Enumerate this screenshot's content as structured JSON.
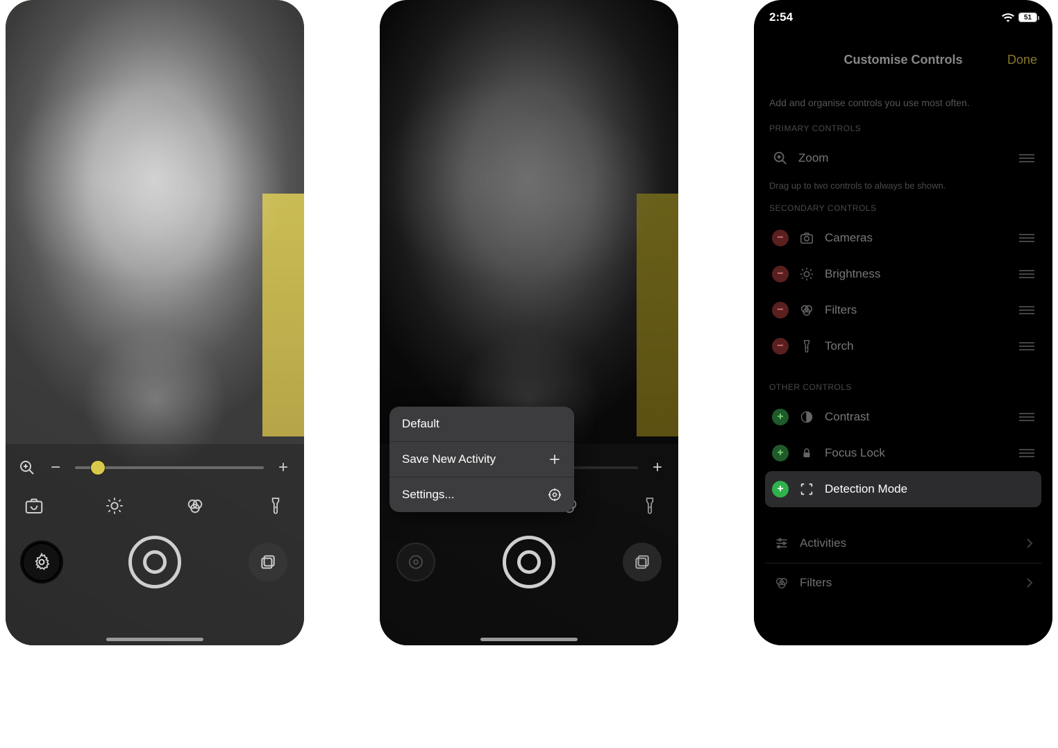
{
  "screen1": {
    "tools": {
      "camera": "camera",
      "brightness": "brightness",
      "filters": "filters",
      "torch": "torch"
    }
  },
  "screen2": {
    "popup": {
      "default": "Default",
      "save_activity": "Save New Activity",
      "settings": "Settings..."
    }
  },
  "screen3": {
    "status": {
      "time": "2:54",
      "battery": "51"
    },
    "nav": {
      "title": "Customise Controls",
      "done": "Done"
    },
    "hint": "Add and organise controls you use most often.",
    "primary_header": "PRIMARY CONTROLS",
    "primary": {
      "zoom": "Zoom"
    },
    "primary_hint": "Drag up to two controls to always be shown.",
    "secondary_header": "SECONDARY CONTROLS",
    "secondary": {
      "cameras": "Cameras",
      "brightness": "Brightness",
      "filters": "Filters",
      "torch": "Torch"
    },
    "other_header": "OTHER CONTROLS",
    "other": {
      "contrast": "Contrast",
      "focus_lock": "Focus Lock",
      "detection_mode": "Detection Mode"
    },
    "list": {
      "activities": "Activities",
      "filters": "Filters"
    }
  }
}
